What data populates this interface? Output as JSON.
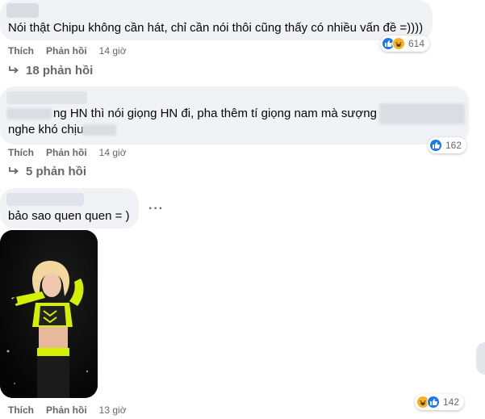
{
  "comments": [
    {
      "text": "Nói thật Chipu không cần hát, chỉ cần nói thôi cũng thấy có nhiều vấn đề =))))",
      "actions": {
        "like": "Thích",
        "reply": "Phản hồi",
        "time": "14 giờ"
      },
      "reactions": {
        "icons": [
          "like-icon",
          "haha-icon"
        ],
        "count": "614"
      },
      "replies_label": "18 phản hồi"
    },
    {
      "text_line1": "ng HN thì nói giọng HN đi, pha thêm tí giọng nam mà sượng",
      "text_line2": "nghe khó chịu",
      "actions": {
        "like": "Thích",
        "reply": "Phản hồi",
        "time": "14 giờ"
      },
      "reactions": {
        "icons": [
          "like-icon"
        ],
        "count": "162"
      },
      "replies_label": "5 phản hồi"
    },
    {
      "text": "bảo sao quen quen = )",
      "more": "···",
      "actions": {
        "like": "Thích",
        "reply": "Phản hồi",
        "time": "13 giờ"
      },
      "reactions": {
        "icons": [
          "haha-icon",
          "like-icon"
        ],
        "count": "142"
      }
    }
  ],
  "colors": {
    "bubble": "#f0f2f5",
    "meta": "#65676b",
    "like": "#1877f2",
    "haha": "#f7b125",
    "outfit": "#d4f000"
  }
}
